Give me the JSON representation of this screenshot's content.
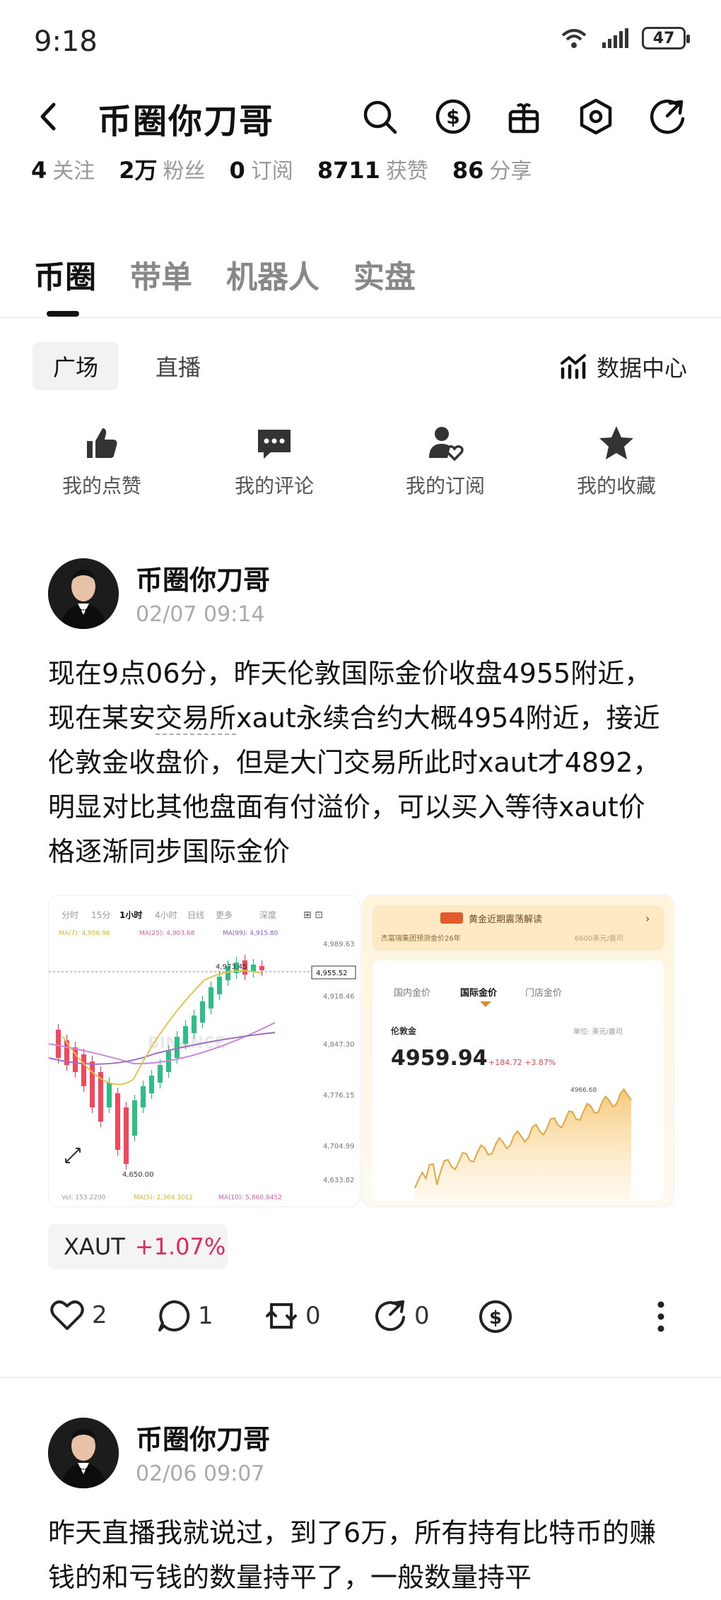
{
  "status_bar": {
    "time": "9:18",
    "battery": "47"
  },
  "header": {
    "title": "币圈你刀哥"
  },
  "stats": [
    {
      "value": "4",
      "label": "关注"
    },
    {
      "value": "2万",
      "label": "粉丝"
    },
    {
      "value": "0",
      "label": "订阅"
    },
    {
      "value": "8711",
      "label": "获赞"
    },
    {
      "value": "86",
      "label": "分享"
    }
  ],
  "tabs": [
    "币圈",
    "带单",
    "机器人",
    "实盘"
  ],
  "subtabs": {
    "active": "广场",
    "other": "直播",
    "data_center": "数据中心"
  },
  "quick_actions": [
    "我的点赞",
    "我的评论",
    "我的订阅",
    "我的收藏"
  ],
  "posts": [
    {
      "author": "币圈你刀哥",
      "date": "02/07 09:14",
      "text_a": "现在9点06分，昨天伦敦国际金价收盘4955附近，现在某安",
      "text_link": "交易所",
      "text_b": "xaut永续合约大概4954附近，接近伦敦金收盘价，但是大门交易所此时xaut才4892，明显对比其他盘面有付溢价，可以买入等待xaut价格逐渐同步国际金价",
      "chart_left": {
        "tabs": [
          "分时",
          "15分",
          "1小时",
          "4小时",
          "日线",
          "更多",
          "深度"
        ],
        "ma": [
          "MA(7): 4,956.96",
          "MA(25): 4,903.68",
          "MA(99): 4,915.80"
        ],
        "axis": [
          "4,989.63",
          "4,955.52",
          "4,918.46",
          "4,847.30",
          "4,776.15",
          "4,704.99",
          "4,633.82"
        ],
        "high_label": "4,973.45",
        "low_label": "4,650.00",
        "watermark": "BINANCE",
        "footer": [
          "Vol: 153.2200",
          "MA(5): 2,364.3012",
          "MA(10): 5,860.8452"
        ]
      },
      "chart_right": {
        "banner": "黄金近期震荡解读",
        "sub": "杰富瑞集团预测金价26年",
        "sub_right": "6600美元/盎司",
        "tabs": [
          "国内金价",
          "国际金价",
          "门店金价"
        ],
        "name": "伦敦金",
        "unit": "单位: 美元/盎司",
        "price": "4959.94",
        "change": "+184.72 +3.87%",
        "peak": "4966.68"
      },
      "ticker": {
        "symbol": "XAUT",
        "change": "+1.07%"
      },
      "actions": {
        "likes": "2",
        "comments": "1",
        "reposts": "0",
        "shares": "0"
      }
    },
    {
      "author": "币圈你刀哥",
      "date": "02/06 09:07",
      "text": "昨天直播我就说过，到了6万，所有持有比特币的赚钱的和亏钱的数量持平了，一般数量持平"
    }
  ]
}
